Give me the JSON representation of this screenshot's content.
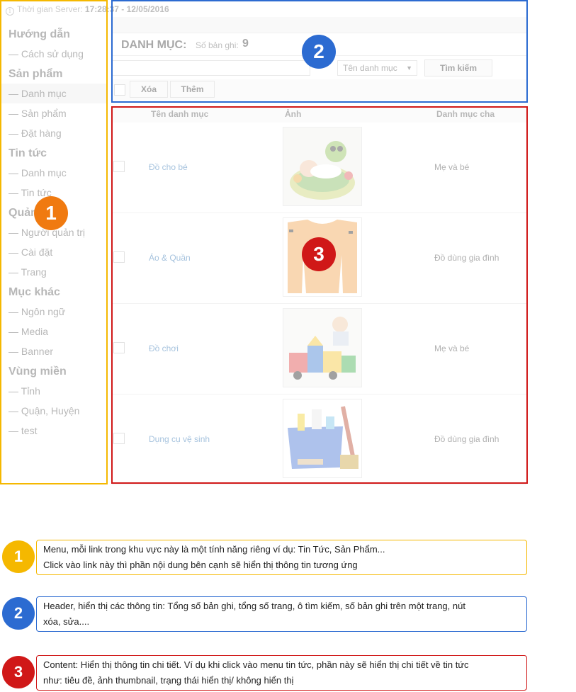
{
  "server": {
    "label": "Thời gian Server:",
    "value": "17:28:37 - 12/05/2016"
  },
  "sidebar": {
    "groups": [
      {
        "heading": "Hướng dẫn",
        "items": [
          "— Cách sử dụng"
        ]
      },
      {
        "heading": "Sản phẩm",
        "items": [
          "— Danh mục",
          "— Sản phẩm",
          "— Đặt hàng"
        ]
      },
      {
        "heading": "Tin tức",
        "items": [
          "— Danh mục",
          "— Tin tức"
        ]
      },
      {
        "heading": "Quản trị",
        "items": [
          "— Người quản trị",
          "— Cài đặt",
          "— Trang"
        ]
      },
      {
        "heading": "Mục khác",
        "items": [
          "— Ngôn ngữ",
          "— Media",
          "— Banner"
        ]
      },
      {
        "heading": "Vùng miền",
        "items": [
          "— Tỉnh",
          "— Quận, Huyện",
          "— test"
        ]
      }
    ]
  },
  "header": {
    "title": "DANH MỤC:",
    "count_label": "Số bản ghi:",
    "count_value": "9",
    "search_placeholder": "",
    "select_value": "Tên danh mục",
    "search_button": "Tìm kiếm",
    "delete_button": "Xóa",
    "add_button": "Thêm"
  },
  "table": {
    "columns": [
      "Tên danh mục",
      "Ảnh",
      "Danh mục cha"
    ],
    "rows": [
      {
        "name": "Đồ cho bé",
        "parent": "Mẹ và bé",
        "image": "baby-photo"
      },
      {
        "name": "Áo & Quần",
        "parent": "Đồ dùng gia đình",
        "image": "shirt-photo"
      },
      {
        "name": "Đồ chơi",
        "parent": "Mẹ và bé",
        "image": "toys-photo"
      },
      {
        "name": "Dụng cụ vệ sinh",
        "parent": "Đồ dùng gia đình",
        "image": "cleaning-photo"
      }
    ]
  },
  "markers": [
    "1",
    "2",
    "3"
  ],
  "colors": {
    "menu": "#f5b800",
    "header": "#2c6bd1",
    "content": "#d01818",
    "marker1": "#f07a10"
  },
  "legend": [
    {
      "number": "1",
      "lines": [
        "Menu, mỗi link trong khu vực này là một tính năng riêng ví dụ: Tin Tức, Sản Phẩm...",
        "Click vào link này thì phần nội dung bên cạnh sẽ hiển thị thông tin tương ứng"
      ]
    },
    {
      "number": "2",
      "lines": [
        "Header, hiển thị các thông tin: Tổng số bản ghi, tổng số trang, ô tìm kiếm, số bản ghi trên một trang, nút",
        "xóa, sửa...."
      ]
    },
    {
      "number": "3",
      "lines": [
        "Content: Hiển thị thông tin chi tiết. Ví dụ khi click vào menu tin tức, phần này sẽ hiển thị chi tiết về tin tức",
        "như: tiêu đề, ảnh thumbnail, trạng thái hiển thị/ không hiển thị"
      ]
    }
  ]
}
